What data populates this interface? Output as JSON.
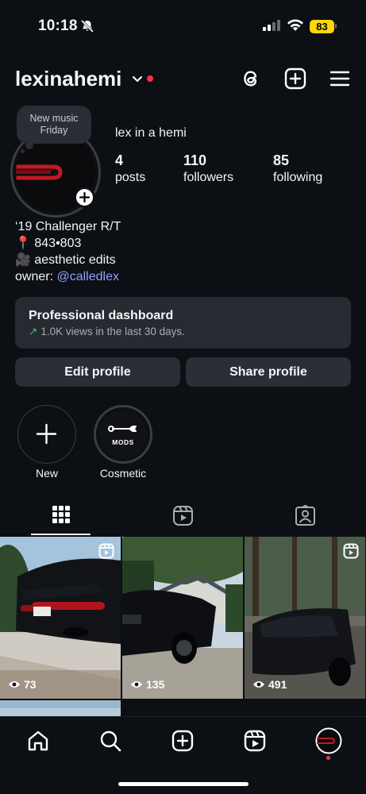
{
  "status_bar": {
    "time": "10:18",
    "battery": "83"
  },
  "header": {
    "username": "lexinahemi"
  },
  "profile": {
    "note": "New music Friday",
    "display_name": "lex in a hemi",
    "stats": [
      {
        "value": "4",
        "label": "posts"
      },
      {
        "value": "110",
        "label": "followers"
      },
      {
        "value": "85",
        "label": "following"
      }
    ],
    "bio": {
      "line1": "‘19 Challenger R/T",
      "line2_icon": "📍",
      "line2": "843•803",
      "line3_icon": "🎥",
      "line3": "aesthetic edits",
      "owner_prefix": "owner: ",
      "owner_link": "@calledlex"
    }
  },
  "dashboard": {
    "title": "Professional dashboard",
    "arrow": "↗",
    "subtitle": "1.0K views in the last 30 days."
  },
  "buttons": {
    "edit": "Edit profile",
    "share": "Share profile"
  },
  "highlights": [
    {
      "label": "New"
    },
    {
      "label": "Cosmetic",
      "badge": "MODS"
    }
  ],
  "grid": [
    {
      "views": "73"
    },
    {
      "views": "135"
    },
    {
      "views": "491"
    }
  ],
  "colors": {
    "background": "#0c0f14",
    "accent_link": "#8ea2ff",
    "notification": "#ff3040",
    "battery": "#ffd60a"
  },
  "icons": [
    "bell-slash-icon",
    "signal-icon",
    "wifi-icon",
    "threads-icon",
    "create-icon",
    "menu-icon",
    "grid-icon",
    "reels-icon",
    "tagged-icon",
    "home-icon",
    "search-icon",
    "plus-icon",
    "reels-nav-icon",
    "profile-avatar-icon"
  ]
}
